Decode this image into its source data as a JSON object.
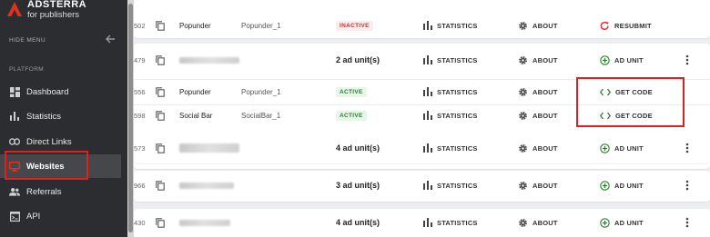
{
  "brand": {
    "name": "ADSTERRA",
    "tagline": "for publishers",
    "accent": "#e0301e"
  },
  "sidebar": {
    "hide_menu_label": "HIDE MENU",
    "section_label": "PLATFORM",
    "items": [
      {
        "label": "Dashboard",
        "icon": "dashboard-icon",
        "active": false
      },
      {
        "label": "Statistics",
        "icon": "bar-chart-icon",
        "active": false
      },
      {
        "label": "Direct Links",
        "icon": "link-icon",
        "active": false
      },
      {
        "label": "Websites",
        "icon": "monitor-icon",
        "active": true
      },
      {
        "label": "Referrals",
        "icon": "people-icon",
        "active": false
      },
      {
        "label": "API",
        "icon": "terminal-icon",
        "active": false
      }
    ]
  },
  "rows": [
    {
      "id": "502",
      "format": "Popunder",
      "placement": "Popunder_1",
      "status": "INACTIVE",
      "stats": "STATISTICS",
      "about": "ABOUT",
      "action": "RESUBMIT"
    },
    {
      "id": "479",
      "units": "2 ad unit(s)",
      "stats": "STATISTICS",
      "about": "ABOUT",
      "action": "AD UNIT"
    },
    {
      "id": "556",
      "format": "Popunder",
      "placement": "Popunder_1",
      "status": "ACTIVE",
      "stats": "STATISTICS",
      "about": "ABOUT",
      "action": "GET CODE"
    },
    {
      "id": "598",
      "format": "Social Bar",
      "placement": "SocialBar_1",
      "status": "ACTIVE",
      "stats": "STATISTICS",
      "about": "ABOUT",
      "action": "GET CODE"
    },
    {
      "id": "573",
      "units": "4 ad unit(s)",
      "stats": "STATISTICS",
      "about": "ABOUT",
      "action": "AD UNIT"
    },
    {
      "id": "966",
      "units": "3 ad unit(s)",
      "stats": "STATISTICS",
      "about": "ABOUT",
      "action": "AD UNIT"
    },
    {
      "id": "430",
      "units": "4 ad unit(s)",
      "stats": "STATISTICS",
      "about": "ABOUT",
      "action": "AD UNIT"
    }
  ],
  "colors": {
    "sidebar_bg": "#2c2d30",
    "highlight_red": "#e02020",
    "active_green": "#2e7d32",
    "inactive_red": "#d32f2f",
    "resubmit_red": "#e53935"
  }
}
